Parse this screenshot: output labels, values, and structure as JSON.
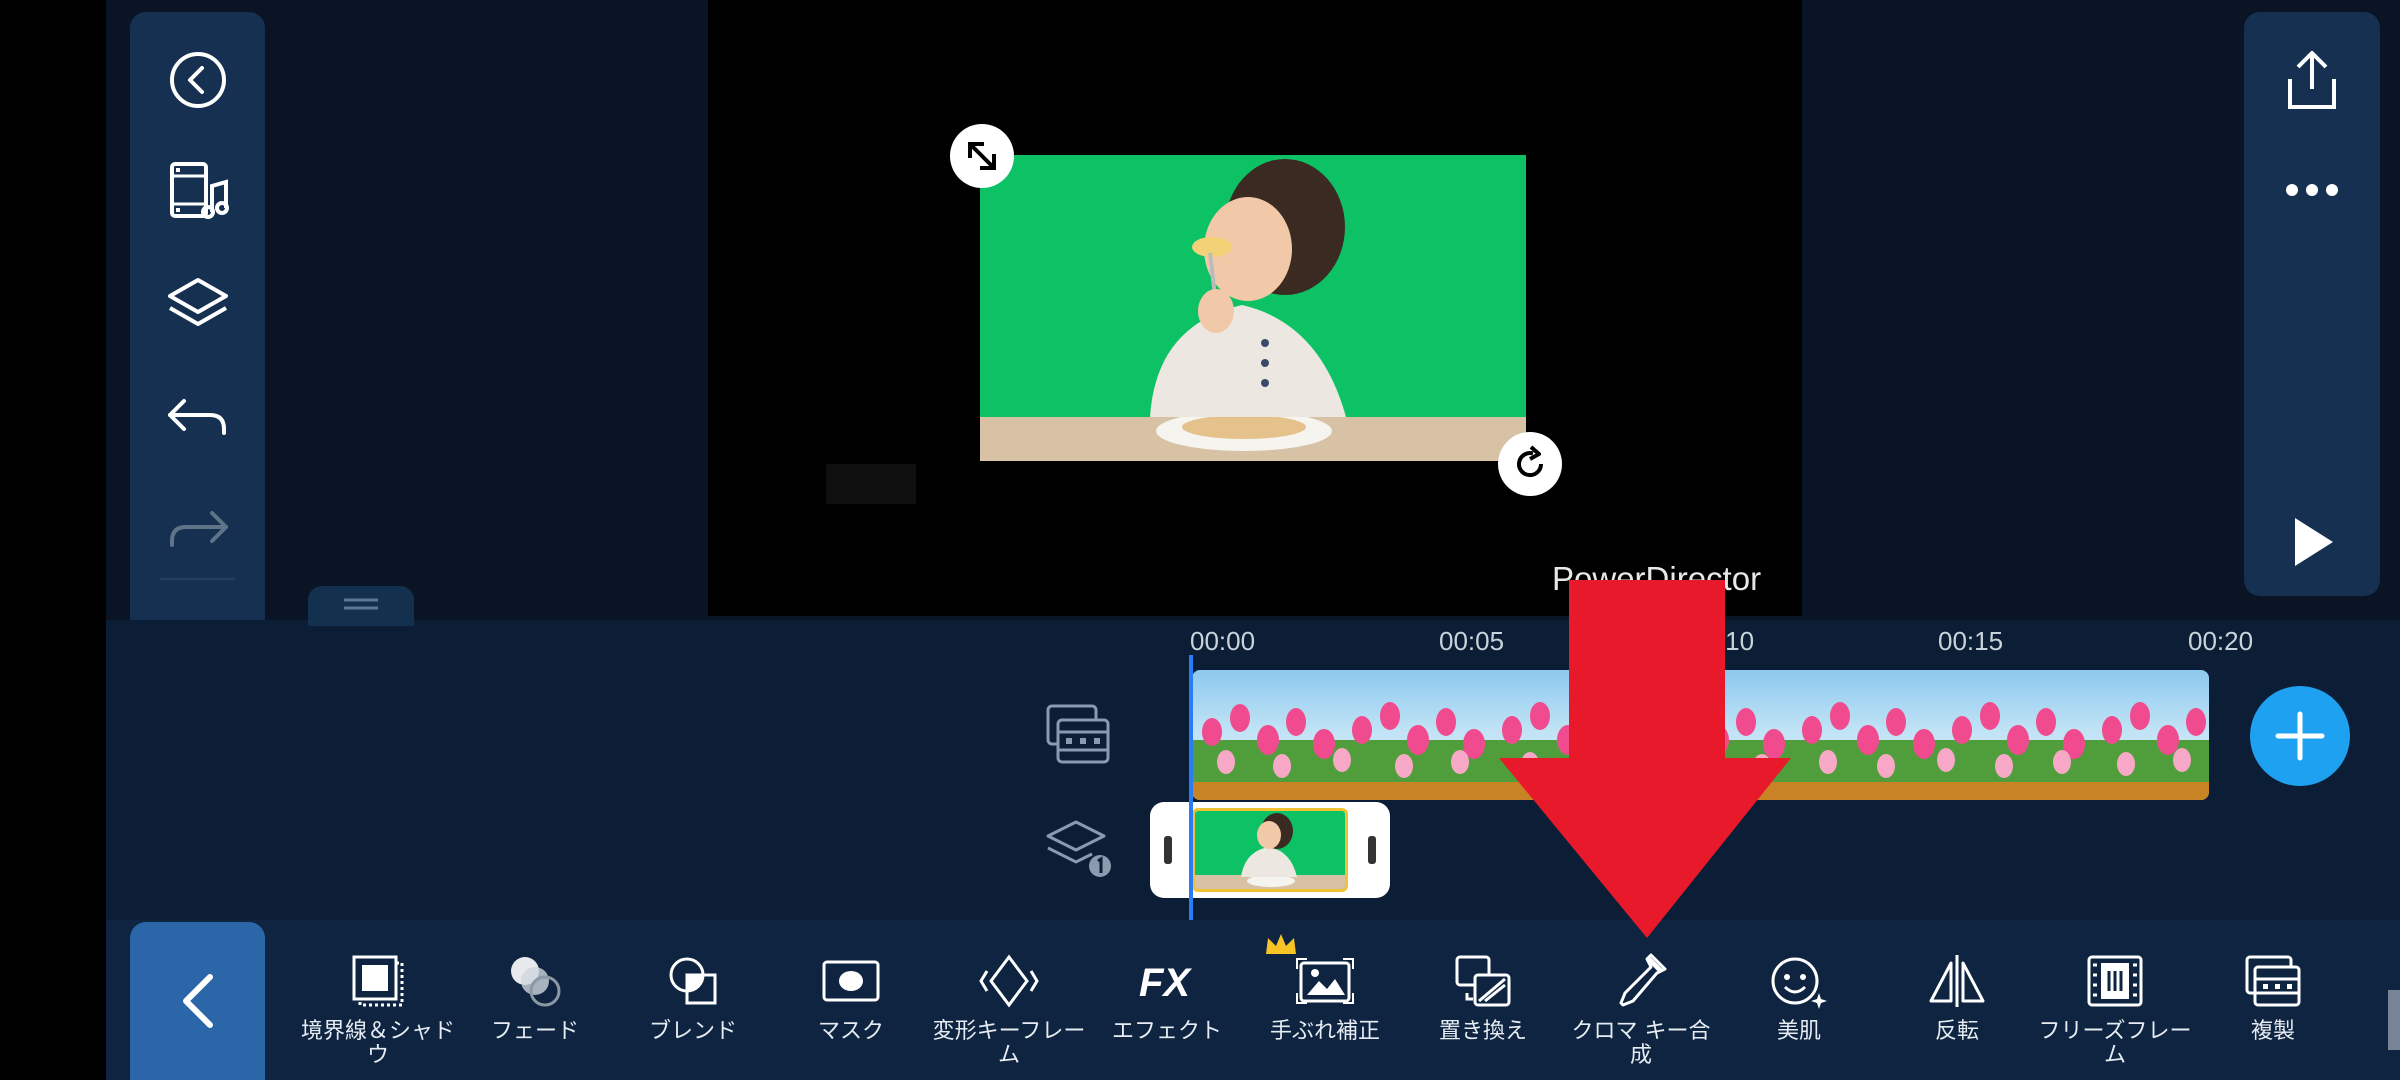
{
  "preview": {
    "watermark": "PowerDirector"
  },
  "timeline": {
    "ruler": [
      "00:00",
      "00:05",
      "00:10",
      "00:15",
      "00:20"
    ]
  },
  "toolbar": {
    "tools": [
      {
        "name": "border-shadow",
        "label": "境界線＆シャドウ"
      },
      {
        "name": "fade",
        "label": "フェード"
      },
      {
        "name": "blend",
        "label": "ブレンド"
      },
      {
        "name": "mask",
        "label": "マスク"
      },
      {
        "name": "transform-keyframe",
        "label": "変形キーフレーム"
      },
      {
        "name": "effect",
        "label": "エフェクト"
      },
      {
        "name": "stabilizer",
        "label": "手ぶれ補正"
      },
      {
        "name": "replace",
        "label": "置き換え"
      },
      {
        "name": "chroma-key",
        "label": "クロマ キー合成"
      },
      {
        "name": "skin-smoothing",
        "label": "美肌"
      },
      {
        "name": "flip",
        "label": "反転"
      },
      {
        "name": "freeze-frame",
        "label": "フリーズフレーム"
      },
      {
        "name": "duplicate",
        "label": "複製"
      }
    ]
  },
  "colors": {
    "accent": "#1ea1f1",
    "panel": "#153050",
    "highlight_arrow": "#e8192b",
    "greenscreen": "#0dc264"
  }
}
